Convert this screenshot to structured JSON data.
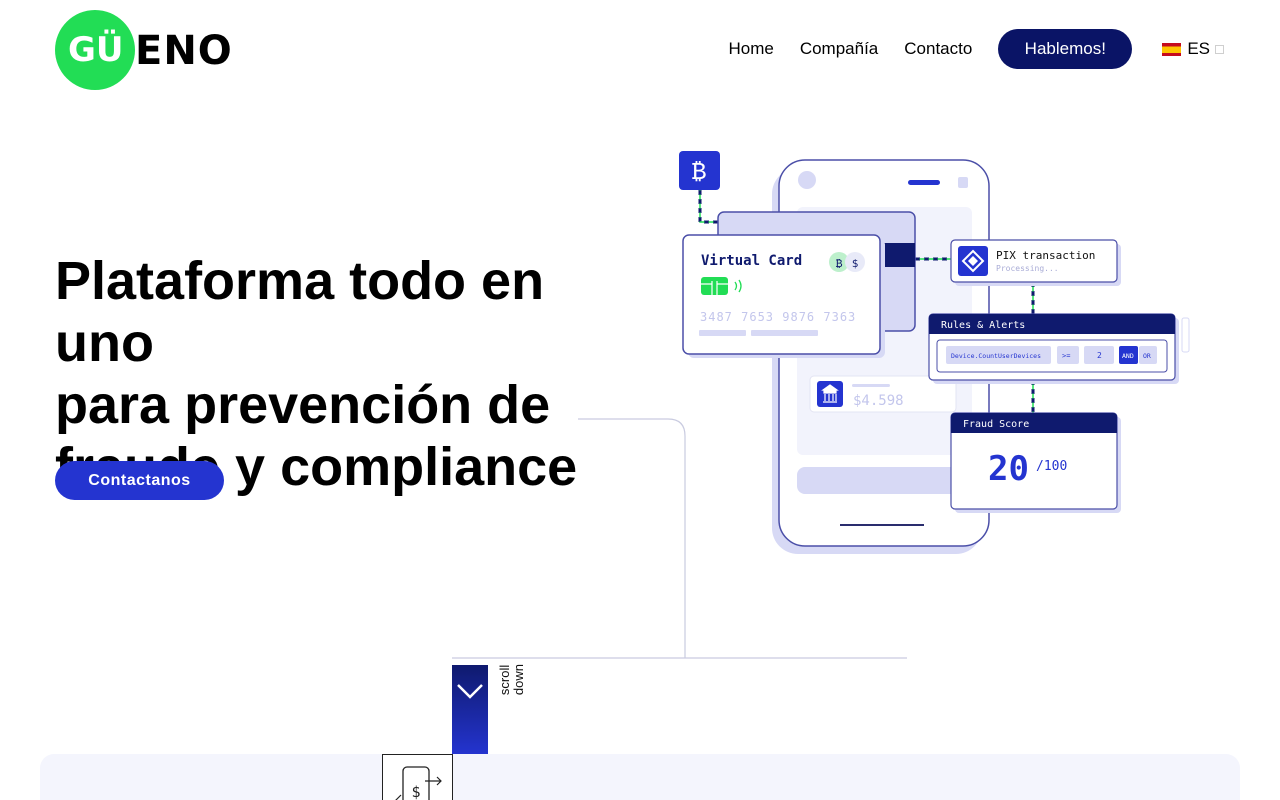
{
  "header": {
    "logo": {
      "part1": "GÜ",
      "part2": "ENO"
    },
    "nav": [
      {
        "label": "Home"
      },
      {
        "label": "Compañía"
      },
      {
        "label": "Contacto"
      }
    ],
    "cta_label": "Hablemos!",
    "language": "ES"
  },
  "hero": {
    "title_line1": "Plataforma todo en uno",
    "title_line2_regular": "para ",
    "title_line2_bold": "prevención de",
    "title_line3_bold": "fraude y compliance",
    "cta_label": "Contactanos"
  },
  "illustration": {
    "virtual_card": {
      "title": "Virtual Card",
      "number": "3487 7653 9876 7363"
    },
    "pix": {
      "title": "PIX transaction",
      "status": "Processing..."
    },
    "rules": {
      "title": "Rules & Alerts",
      "field": "Device.CountUserDevices",
      "operator": ">=",
      "value": "2",
      "and_label": "AND",
      "or_label": "OR"
    },
    "balance": "$4.598",
    "fraud_score": {
      "title": "Fraud Score",
      "value": "20",
      "max": "/100"
    }
  },
  "scroll": {
    "label_line1": "scroll",
    "label_line2": "down"
  },
  "colors": {
    "brand_green": "#22dd55",
    "navy": "#0a1466",
    "primary_blue": "#2434d0",
    "lavender": "#d7d9f5"
  }
}
